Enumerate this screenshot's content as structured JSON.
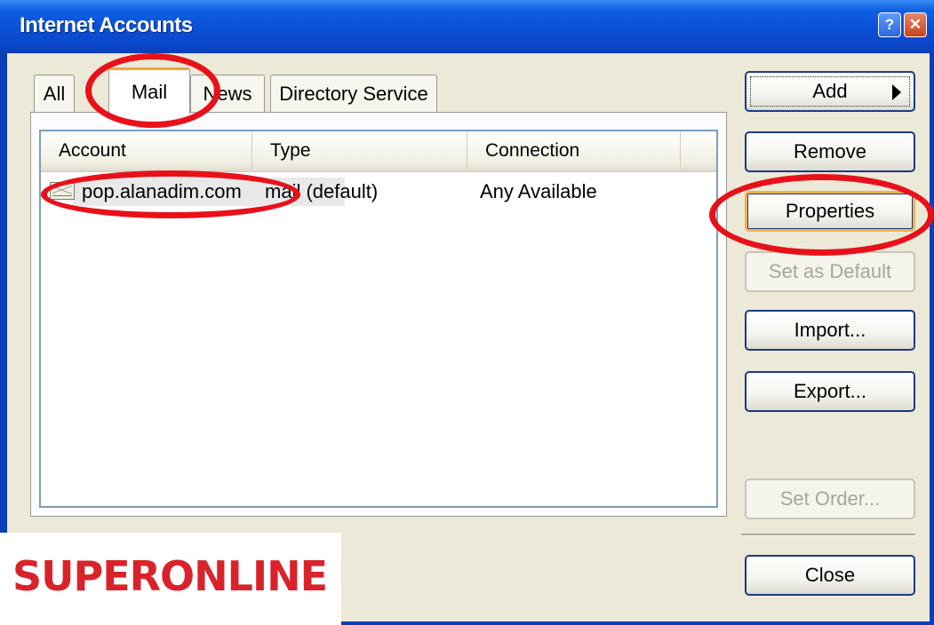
{
  "window": {
    "title": "Internet Accounts",
    "help_glyph": "?",
    "close_glyph": "✕"
  },
  "tabs": [
    {
      "label": "All",
      "selected": false
    },
    {
      "label": "Mail",
      "selected": true
    },
    {
      "label": "News",
      "selected": false
    },
    {
      "label": "Directory Service",
      "selected": false
    }
  ],
  "list": {
    "columns": [
      "Account",
      "Type",
      "Connection"
    ],
    "rows": [
      {
        "account": "pop.alanadim.com",
        "type": "mail (default)",
        "connection": "Any Available",
        "icon": "mail-account-icon"
      }
    ]
  },
  "buttons": {
    "add": "Add",
    "remove": "Remove",
    "properties": "Properties",
    "set_as_default": "Set as Default",
    "import": "Import...",
    "export": "Export...",
    "set_order": "Set Order...",
    "close": "Close"
  },
  "logo": {
    "text": "SUPERONLINE",
    "color": "#d9232b"
  },
  "colors": {
    "title_bar": "#0a4fd6",
    "annotation": "#e8111a",
    "dialog_bg": "#ece9d8"
  }
}
